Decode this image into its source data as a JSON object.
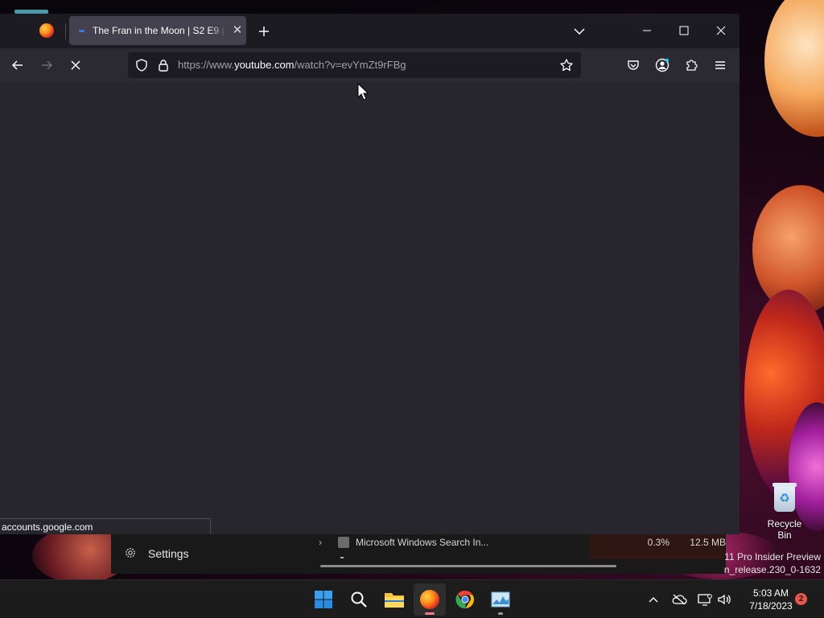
{
  "browser": {
    "tabs": [
      {
        "label": "The Fran in the Moon | S2 E9 | F",
        "active": true
      }
    ],
    "url": {
      "prefix": "https://www.",
      "host": "youtube.com",
      "path": "/watch?v=evYmZt9rFBg"
    },
    "status_text": "accounts.google.com",
    "loading": true
  },
  "background_window": {
    "settings_label": "Settings",
    "process_name": "Microsoft Windows Search In...",
    "cpu": "0.3%",
    "memory": "12.5 MB"
  },
  "desktop": {
    "recycle_bin_label": "Recycle Bin",
    "watermark_line1": "11 Pro Insider Preview",
    "watermark_line2": "n_release.230_0-1632"
  },
  "taskbar": {
    "icons": [
      "start-icon",
      "search-icon",
      "file-explorer-icon",
      "firefox-icon",
      "chrome-icon",
      "task-manager-icon"
    ],
    "time": "5:03 AM",
    "date": "7/18/2023",
    "notification_count": "2"
  },
  "colors": {
    "browser_bg": "#1c1b22",
    "toolbar_bg": "#2b2a33",
    "content_bg": "#27262d",
    "active_tab": "#42414d",
    "taskbar_bg": "#1c1c1c"
  }
}
